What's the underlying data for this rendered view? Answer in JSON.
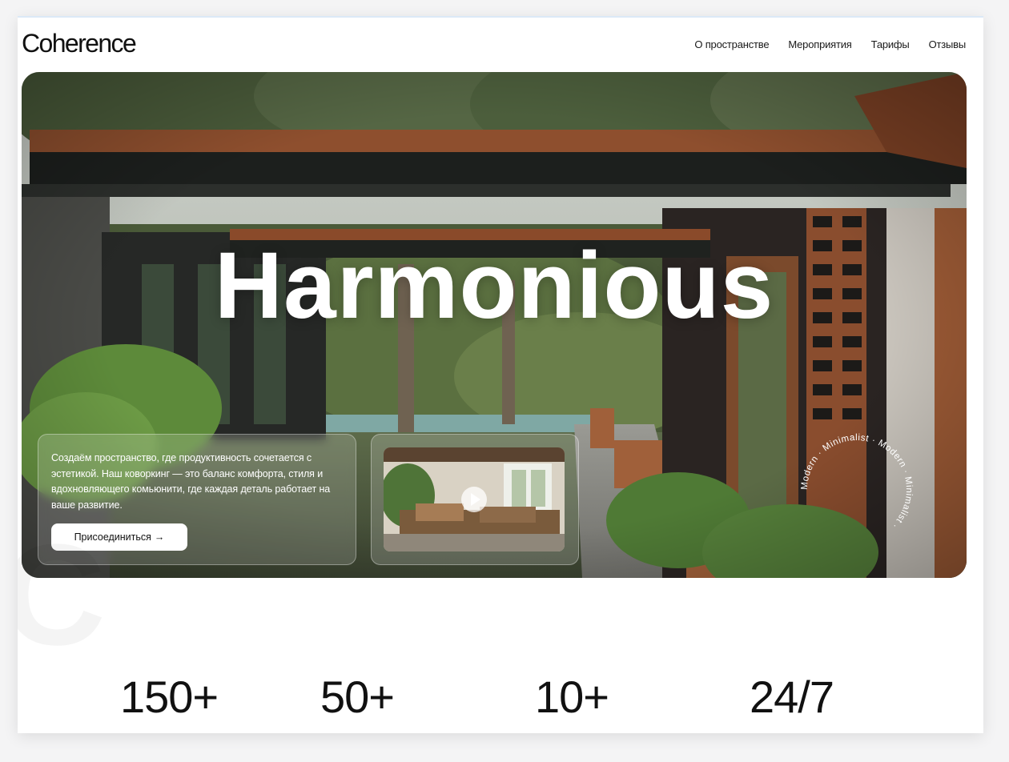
{
  "brand": {
    "logo": "Coherence"
  },
  "nav": {
    "items": [
      "О пространстве",
      "Мероприятия",
      "Тарифы",
      "Отзывы"
    ]
  },
  "hero": {
    "headline": "Harmonious",
    "description": "Создаём пространство, где продуктивность сочетается с эстетикой. Наш коворкинг — это баланс комфорта, стиля и вдохновляющего комьюнити, где каждая деталь работает на ваше развитие.",
    "cta_label": "Присоединиться",
    "cta_icon": "arrow-right-icon",
    "ring_text": "Modern · Minimalist · Modern · Minimalist · ",
    "video_icon": "play-icon"
  },
  "stats": [
    "150+",
    "50+",
    "10+",
    "24/7"
  ],
  "colors": {
    "wood": "#8a4a2a",
    "beam": "#1c1f1d",
    "foliage": "#3f5a2e",
    "sky": "#c9cdc8",
    "text_dark": "#111111"
  }
}
